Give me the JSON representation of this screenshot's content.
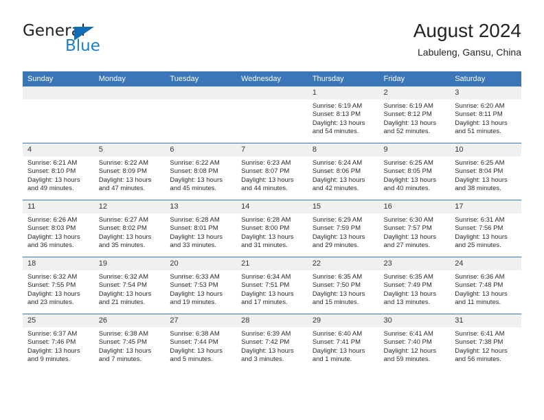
{
  "brand": {
    "name_top": "General",
    "name_bottom": "Blue",
    "accent_color": "#1b7fc4",
    "triangle_color": "#0f6cb5"
  },
  "header": {
    "title": "August 2024",
    "subtitle": "Labuleng, Gansu, China"
  },
  "theme": {
    "header_row_bg": "#3b76b8",
    "daynum_bg": "#f0f0f0",
    "text_color": "#2a2a2a"
  },
  "weekdays": [
    "Sunday",
    "Monday",
    "Tuesday",
    "Wednesday",
    "Thursday",
    "Friday",
    "Saturday"
  ],
  "weeks": [
    [
      {
        "day": "",
        "empty": true
      },
      {
        "day": "",
        "empty": true
      },
      {
        "day": "",
        "empty": true
      },
      {
        "day": "",
        "empty": true
      },
      {
        "day": "1",
        "sunrise": "Sunrise: 6:19 AM",
        "sunset": "Sunset: 8:13 PM",
        "daylight": "Daylight: 13 hours and 54 minutes."
      },
      {
        "day": "2",
        "sunrise": "Sunrise: 6:19 AM",
        "sunset": "Sunset: 8:12 PM",
        "daylight": "Daylight: 13 hours and 52 minutes."
      },
      {
        "day": "3",
        "sunrise": "Sunrise: 6:20 AM",
        "sunset": "Sunset: 8:11 PM",
        "daylight": "Daylight: 13 hours and 51 minutes."
      }
    ],
    [
      {
        "day": "4",
        "sunrise": "Sunrise: 6:21 AM",
        "sunset": "Sunset: 8:10 PM",
        "daylight": "Daylight: 13 hours and 49 minutes."
      },
      {
        "day": "5",
        "sunrise": "Sunrise: 6:22 AM",
        "sunset": "Sunset: 8:09 PM",
        "daylight": "Daylight: 13 hours and 47 minutes."
      },
      {
        "day": "6",
        "sunrise": "Sunrise: 6:22 AM",
        "sunset": "Sunset: 8:08 PM",
        "daylight": "Daylight: 13 hours and 45 minutes."
      },
      {
        "day": "7",
        "sunrise": "Sunrise: 6:23 AM",
        "sunset": "Sunset: 8:07 PM",
        "daylight": "Daylight: 13 hours and 44 minutes."
      },
      {
        "day": "8",
        "sunrise": "Sunrise: 6:24 AM",
        "sunset": "Sunset: 8:06 PM",
        "daylight": "Daylight: 13 hours and 42 minutes."
      },
      {
        "day": "9",
        "sunrise": "Sunrise: 6:25 AM",
        "sunset": "Sunset: 8:05 PM",
        "daylight": "Daylight: 13 hours and 40 minutes."
      },
      {
        "day": "10",
        "sunrise": "Sunrise: 6:25 AM",
        "sunset": "Sunset: 8:04 PM",
        "daylight": "Daylight: 13 hours and 38 minutes."
      }
    ],
    [
      {
        "day": "11",
        "sunrise": "Sunrise: 6:26 AM",
        "sunset": "Sunset: 8:03 PM",
        "daylight": "Daylight: 13 hours and 36 minutes."
      },
      {
        "day": "12",
        "sunrise": "Sunrise: 6:27 AM",
        "sunset": "Sunset: 8:02 PM",
        "daylight": "Daylight: 13 hours and 35 minutes."
      },
      {
        "day": "13",
        "sunrise": "Sunrise: 6:28 AM",
        "sunset": "Sunset: 8:01 PM",
        "daylight": "Daylight: 13 hours and 33 minutes."
      },
      {
        "day": "14",
        "sunrise": "Sunrise: 6:28 AM",
        "sunset": "Sunset: 8:00 PM",
        "daylight": "Daylight: 13 hours and 31 minutes."
      },
      {
        "day": "15",
        "sunrise": "Sunrise: 6:29 AM",
        "sunset": "Sunset: 7:59 PM",
        "daylight": "Daylight: 13 hours and 29 minutes."
      },
      {
        "day": "16",
        "sunrise": "Sunrise: 6:30 AM",
        "sunset": "Sunset: 7:57 PM",
        "daylight": "Daylight: 13 hours and 27 minutes."
      },
      {
        "day": "17",
        "sunrise": "Sunrise: 6:31 AM",
        "sunset": "Sunset: 7:56 PM",
        "daylight": "Daylight: 13 hours and 25 minutes."
      }
    ],
    [
      {
        "day": "18",
        "sunrise": "Sunrise: 6:32 AM",
        "sunset": "Sunset: 7:55 PM",
        "daylight": "Daylight: 13 hours and 23 minutes."
      },
      {
        "day": "19",
        "sunrise": "Sunrise: 6:32 AM",
        "sunset": "Sunset: 7:54 PM",
        "daylight": "Daylight: 13 hours and 21 minutes."
      },
      {
        "day": "20",
        "sunrise": "Sunrise: 6:33 AM",
        "sunset": "Sunset: 7:53 PM",
        "daylight": "Daylight: 13 hours and 19 minutes."
      },
      {
        "day": "21",
        "sunrise": "Sunrise: 6:34 AM",
        "sunset": "Sunset: 7:51 PM",
        "daylight": "Daylight: 13 hours and 17 minutes."
      },
      {
        "day": "22",
        "sunrise": "Sunrise: 6:35 AM",
        "sunset": "Sunset: 7:50 PM",
        "daylight": "Daylight: 13 hours and 15 minutes."
      },
      {
        "day": "23",
        "sunrise": "Sunrise: 6:35 AM",
        "sunset": "Sunset: 7:49 PM",
        "daylight": "Daylight: 13 hours and 13 minutes."
      },
      {
        "day": "24",
        "sunrise": "Sunrise: 6:36 AM",
        "sunset": "Sunset: 7:48 PM",
        "daylight": "Daylight: 13 hours and 11 minutes."
      }
    ],
    [
      {
        "day": "25",
        "sunrise": "Sunrise: 6:37 AM",
        "sunset": "Sunset: 7:46 PM",
        "daylight": "Daylight: 13 hours and 9 minutes."
      },
      {
        "day": "26",
        "sunrise": "Sunrise: 6:38 AM",
        "sunset": "Sunset: 7:45 PM",
        "daylight": "Daylight: 13 hours and 7 minutes."
      },
      {
        "day": "27",
        "sunrise": "Sunrise: 6:38 AM",
        "sunset": "Sunset: 7:44 PM",
        "daylight": "Daylight: 13 hours and 5 minutes."
      },
      {
        "day": "28",
        "sunrise": "Sunrise: 6:39 AM",
        "sunset": "Sunset: 7:42 PM",
        "daylight": "Daylight: 13 hours and 3 minutes."
      },
      {
        "day": "29",
        "sunrise": "Sunrise: 6:40 AM",
        "sunset": "Sunset: 7:41 PM",
        "daylight": "Daylight: 13 hours and 1 minute."
      },
      {
        "day": "30",
        "sunrise": "Sunrise: 6:41 AM",
        "sunset": "Sunset: 7:40 PM",
        "daylight": "Daylight: 12 hours and 59 minutes."
      },
      {
        "day": "31",
        "sunrise": "Sunrise: 6:41 AM",
        "sunset": "Sunset: 7:38 PM",
        "daylight": "Daylight: 12 hours and 56 minutes."
      }
    ]
  ]
}
